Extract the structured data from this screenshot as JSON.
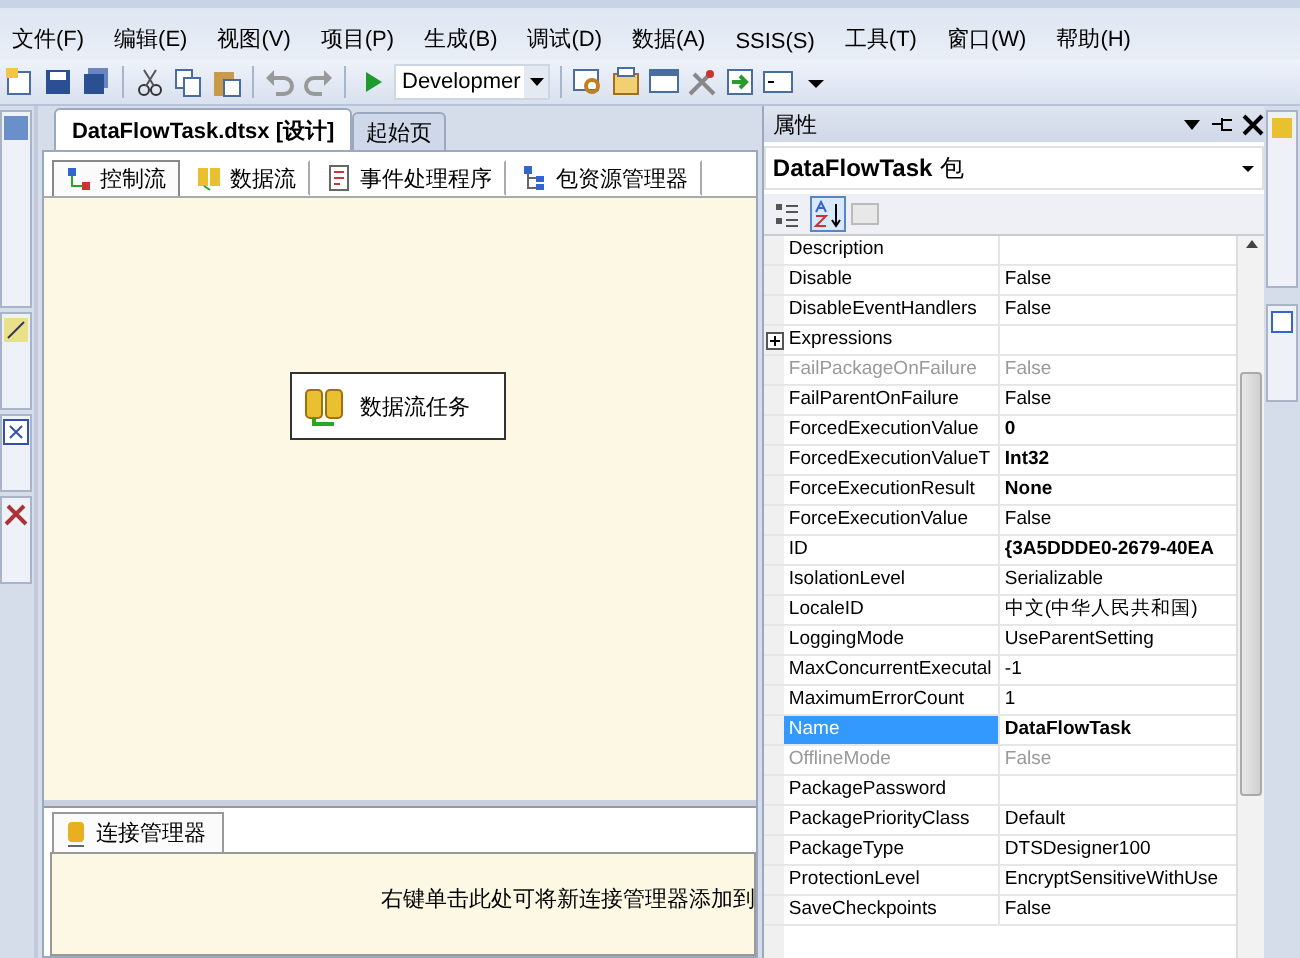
{
  "menu": [
    "文件(F)",
    "编辑(E)",
    "视图(V)",
    "项目(P)",
    "生成(B)",
    "调试(D)",
    "数据(A)",
    "SSIS(S)",
    "工具(T)",
    "窗口(W)",
    "帮助(H)"
  ],
  "toolbar": {
    "configuration": "Developmer"
  },
  "document_tabs": [
    {
      "label": "DataFlowTask.dtsx [设计]",
      "selected": true
    },
    {
      "label": "起始页",
      "selected": false
    }
  ],
  "designer_tabs": [
    {
      "label": "控制流",
      "selected": true
    },
    {
      "label": "数据流",
      "selected": false
    },
    {
      "label": "事件处理程序",
      "selected": false
    },
    {
      "label": "包资源管理器",
      "selected": false
    }
  ],
  "canvas": {
    "task": "数据流任务"
  },
  "connection_managers": {
    "tab": "连接管理器",
    "hint": "右键单击此处可将新连接管理器添加到"
  },
  "properties": {
    "title": "属性",
    "object": "DataFlowTask",
    "object_type": "包",
    "sort_buttons": [
      {
        "selected": false
      },
      {
        "selected": true
      }
    ],
    "rows": [
      {
        "kind": "property",
        "name": "Description",
        "value": "",
        "disabled": false,
        "selected": false
      },
      {
        "kind": "property",
        "name": "Disable",
        "value": "False",
        "bold": false,
        "disabled": false,
        "selected": false
      },
      {
        "kind": "property",
        "name": "DisableEventHandlers",
        "value": "False",
        "bold": false,
        "disabled": false,
        "selected": false
      },
      {
        "kind": "expandable",
        "name": "Expressions",
        "value": "",
        "disabled": false,
        "selected": false
      },
      {
        "kind": "property",
        "name": "FailPackageOnFailure",
        "value": "False",
        "bold": false,
        "disabled": true,
        "selected": false
      },
      {
        "kind": "property",
        "name": "FailParentOnFailure",
        "value": "False",
        "bold": false,
        "disabled": false,
        "selected": false
      },
      {
        "kind": "property",
        "name": "ForcedExecutionValue",
        "value": "0",
        "bold": true,
        "disabled": false,
        "selected": false
      },
      {
        "kind": "property",
        "name": "ForcedExecutionValueT",
        "value": "Int32",
        "bold": true,
        "disabled": false,
        "selected": false
      },
      {
        "kind": "property",
        "name": "ForceExecutionResult",
        "value": "None",
        "bold": true,
        "disabled": false,
        "selected": false
      },
      {
        "kind": "property",
        "name": "ForceExecutionValue",
        "value": "False",
        "bold": false,
        "disabled": false,
        "selected": false
      },
      {
        "kind": "property",
        "name": "ID",
        "value": "{3A5DDDE0-2679-40EA",
        "bold": true,
        "disabled": false,
        "selected": false
      },
      {
        "kind": "property",
        "name": "IsolationLevel",
        "value": "Serializable",
        "bold": false,
        "disabled": false,
        "selected": false
      },
      {
        "kind": "property",
        "name": "LocaleID",
        "value": "中文(中华人民共和国)",
        "bold": false,
        "disabled": false,
        "selected": false
      },
      {
        "kind": "property",
        "name": "LoggingMode",
        "value": "UseParentSetting",
        "bold": false,
        "disabled": false,
        "selected": false
      },
      {
        "kind": "property",
        "name": "MaxConcurrentExecutal",
        "value": "-1",
        "bold": false,
        "disabled": false,
        "selected": false
      },
      {
        "kind": "property",
        "name": "MaximumErrorCount",
        "value": "1",
        "bold": false,
        "disabled": false,
        "selected": false
      },
      {
        "kind": "property",
        "name": "Name",
        "value": "DataFlowTask",
        "bold": true,
        "disabled": false,
        "selected": true
      },
      {
        "kind": "property",
        "name": "OfflineMode",
        "value": "False",
        "bold": false,
        "disabled": true,
        "selected": false
      },
      {
        "kind": "property",
        "name": "PackagePassword",
        "value": "",
        "disabled": false,
        "selected": false
      },
      {
        "kind": "property",
        "name": "PackagePriorityClass",
        "value": "Default",
        "bold": false,
        "disabled": false,
        "selected": false
      },
      {
        "kind": "property",
        "name": "PackageType",
        "value": "DTSDesigner100",
        "bold": false,
        "disabled": false,
        "selected": false
      },
      {
        "kind": "property",
        "name": "ProtectionLevel",
        "value": "EncryptSensitiveWithUse",
        "bold": false,
        "disabled": false,
        "selected": false
      },
      {
        "kind": "property",
        "name": "SaveCheckpoints",
        "value": "False",
        "bold": false,
        "disabled": false,
        "selected": false
      }
    ]
  }
}
